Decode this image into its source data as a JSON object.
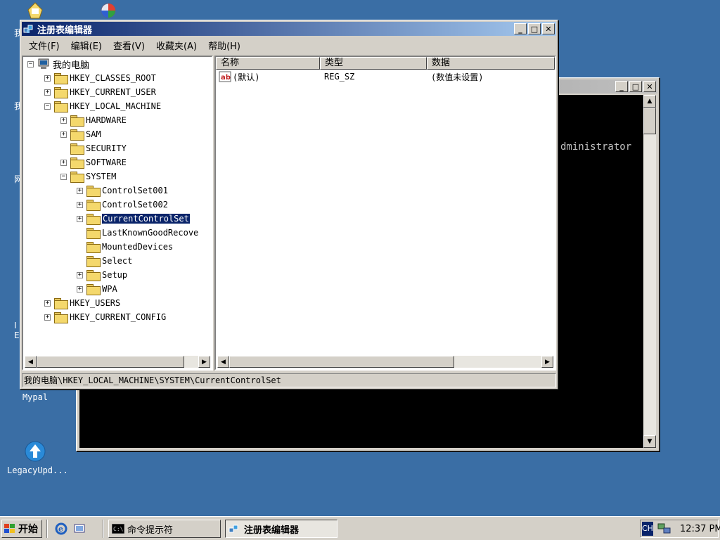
{
  "desktop": {
    "icons": [
      {
        "label": "Mypal"
      },
      {
        "label": "LegacyUpd..."
      }
    ],
    "edge_chars": [
      "我",
      "我",
      "网",
      "I",
      "E"
    ]
  },
  "console": {
    "text": "dministrator"
  },
  "regedit": {
    "title": "注册表编辑器",
    "menu": [
      "文件(F)",
      "编辑(E)",
      "查看(V)",
      "收藏夹(A)",
      "帮助(H)"
    ],
    "tree": {
      "root": "我的电脑",
      "hkcr": "HKEY_CLASSES_ROOT",
      "hkcu": "HKEY_CURRENT_USER",
      "hklm": "HKEY_LOCAL_MACHINE",
      "hardware": "HARDWARE",
      "sam": "SAM",
      "security": "SECURITY",
      "software": "SOFTWARE",
      "system": "SYSTEM",
      "cs001": "ControlSet001",
      "cs002": "ControlSet002",
      "ccs": "CurrentControlSet",
      "lkg": "LastKnownGoodRecove",
      "mounted": "MountedDevices",
      "select": "Select",
      "setup": "Setup",
      "wpa": "WPA",
      "hku": "HKEY_USERS",
      "hkcc": "HKEY_CURRENT_CONFIG"
    },
    "list_headers": [
      "名称",
      "类型",
      "数据"
    ],
    "rows": [
      {
        "name": "(默认)",
        "type": "REG_SZ",
        "data": "(数值未设置)"
      }
    ],
    "status": "我的电脑\\HKEY_LOCAL_MACHINE\\SYSTEM\\CurrentControlSet"
  },
  "taskbar": {
    "start": "开始",
    "tasks": [
      "命令提示符",
      "注册表编辑器"
    ],
    "lang": "CH",
    "clock": "12:37 PM"
  }
}
